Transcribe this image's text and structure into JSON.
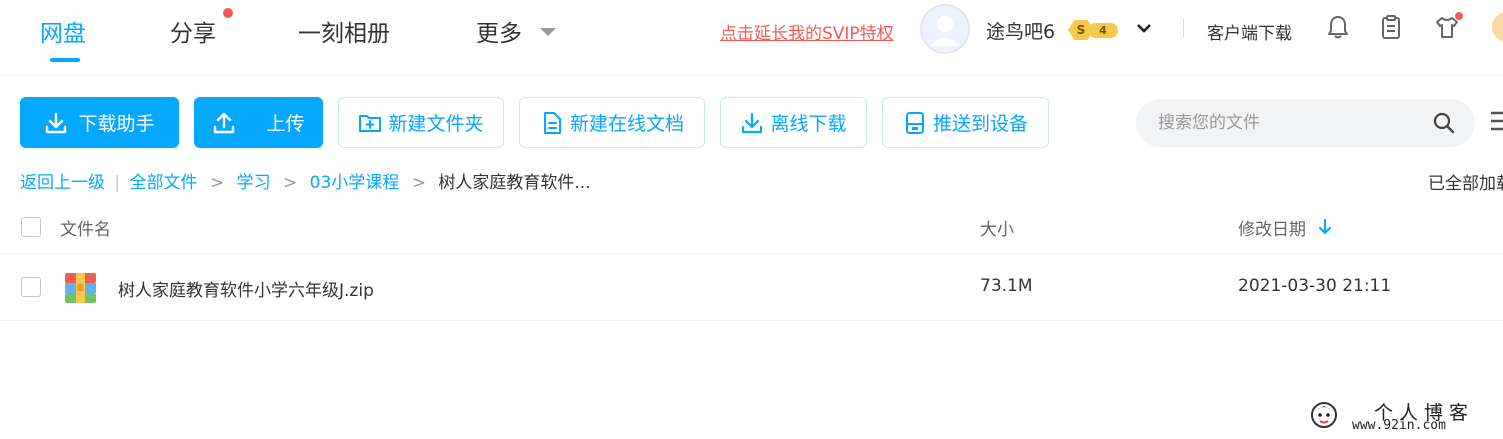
{
  "nav": {
    "tabs": [
      {
        "label": "网盘",
        "active": true
      },
      {
        "label": "分享",
        "has_dot": true
      },
      {
        "label": "一刻相册"
      },
      {
        "label": "更多",
        "has_dropdown": true
      }
    ],
    "svip_link": "点击延长我的SVIP特权",
    "user": {
      "name": "途鸟吧6",
      "badge_symbol": "S",
      "level": "4"
    },
    "client_download": "客户端下载",
    "icons": [
      "bell-icon",
      "clipboard-icon",
      "tshirt-icon"
    ]
  },
  "toolbar": {
    "buttons": [
      {
        "label": "下载助手",
        "icon": "download-icon"
      },
      {
        "label": "上传",
        "icon": "upload-icon"
      },
      {
        "label": "新建文件夹",
        "icon": "new-folder-icon"
      },
      {
        "label": "新建在线文档",
        "icon": "document-icon"
      },
      {
        "label": "离线下载",
        "icon": "download-icon"
      },
      {
        "label": "推送到设备",
        "icon": "device-icon"
      }
    ],
    "search_placeholder": "搜索您的文件"
  },
  "breadcrumb": {
    "back": "返回上一级",
    "divider": "|",
    "items": [
      "全部文件",
      "学习",
      "03小学课程"
    ],
    "current": "树人家庭教育软件...",
    "separator": ">"
  },
  "status": {
    "loaded_text": "已全部加载"
  },
  "table": {
    "columns": {
      "name": "文件名",
      "size": "大小",
      "modified": "修改日期"
    },
    "sort": {
      "column": "modified",
      "direction": "desc"
    },
    "rows": [
      {
        "name": "树人家庭教育软件小学六年级J.zip",
        "size": "73.1M",
        "modified": "2021-03-30 21:11",
        "icon": "zip-file-icon"
      }
    ]
  },
  "watermark": {
    "title": "个人博客",
    "url": "www.92in.com"
  },
  "colors": {
    "accent": "#06a7ff",
    "svip_red": "#f25b56",
    "badge_gold": "#f6c84c",
    "text": "#333333",
    "muted": "#999999"
  }
}
